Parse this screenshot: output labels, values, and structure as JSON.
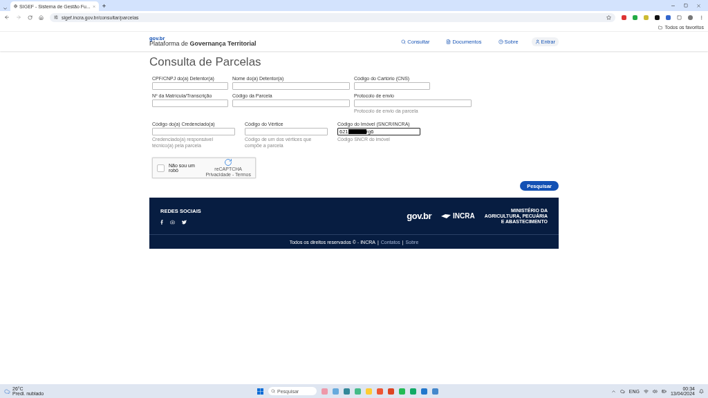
{
  "browser": {
    "tab_title": "SIGEF - Sistema de Gestão Fu...",
    "url": "sigef.incra.gov.br/consultar/parcelas",
    "bookmarks_label": "Todos os favoritos"
  },
  "header": {
    "logo": "gov.br",
    "title_plain": "Plataforma de ",
    "title_bold": "Governança Territorial",
    "nav": [
      {
        "kind": "search",
        "label": "Consultar"
      },
      {
        "kind": "doc",
        "label": "Documentos"
      },
      {
        "kind": "help",
        "label": "Sobre"
      },
      {
        "kind": "user",
        "label": "Entrar"
      }
    ]
  },
  "page_title": "Consulta de Parcelas",
  "form_rows": [
    [
      {
        "label": "CPF/CNPJ do(a) Detentor(a)"
      },
      {
        "label": "Nome do(a) Detentor(a)"
      },
      {
        "label": "Código do Cartório (CNS)"
      }
    ],
    [
      {
        "label": "Nº da Matrícula/Transcrição"
      },
      {
        "label": "Código da Parcela"
      },
      {
        "label": "Protocolo de envio",
        "hint": "Protocolo de envio da parcela"
      }
    ],
    [
      {
        "label": "Código do(a) Credenciado(a)",
        "hint": "Credenciado(a) responsável técnico(a) pela parcela"
      },
      {
        "label": "Código do Vértice",
        "hint": "Código de um dos vértices que compõe a parcela"
      },
      {
        "label": "Código do Imóvel (SNCR/INCRA)",
        "hint": "Código SNCR do imóvel",
        "value_start": "621",
        "value_end": "rg6",
        "redacted": true,
        "focused": true
      }
    ]
  ],
  "captcha": {
    "label": "Não sou um robô",
    "checked": false,
    "brand": "reCAPTCHA",
    "links": "Privacidade - Termos"
  },
  "search_button": "Pesquisar",
  "footer": {
    "social_title": "REDES SOCIAIS",
    "govbr": "gov.br",
    "incra": "INCRA",
    "ministry": [
      "MINISTÉRIO DA",
      "AGRICULTURA, PECUÁRIA",
      "E ABASTECIMENTO"
    ],
    "rights": "Todos os direitos reservados © - INCRA",
    "separator": "|",
    "links": [
      "Contatos",
      "Sobre"
    ]
  },
  "taskbar": {
    "temperature": "26°C",
    "weather": "Predi. nublado",
    "search": "Pesquisar",
    "language": "ENG",
    "time": "00:34",
    "date": "13/04/2024"
  }
}
